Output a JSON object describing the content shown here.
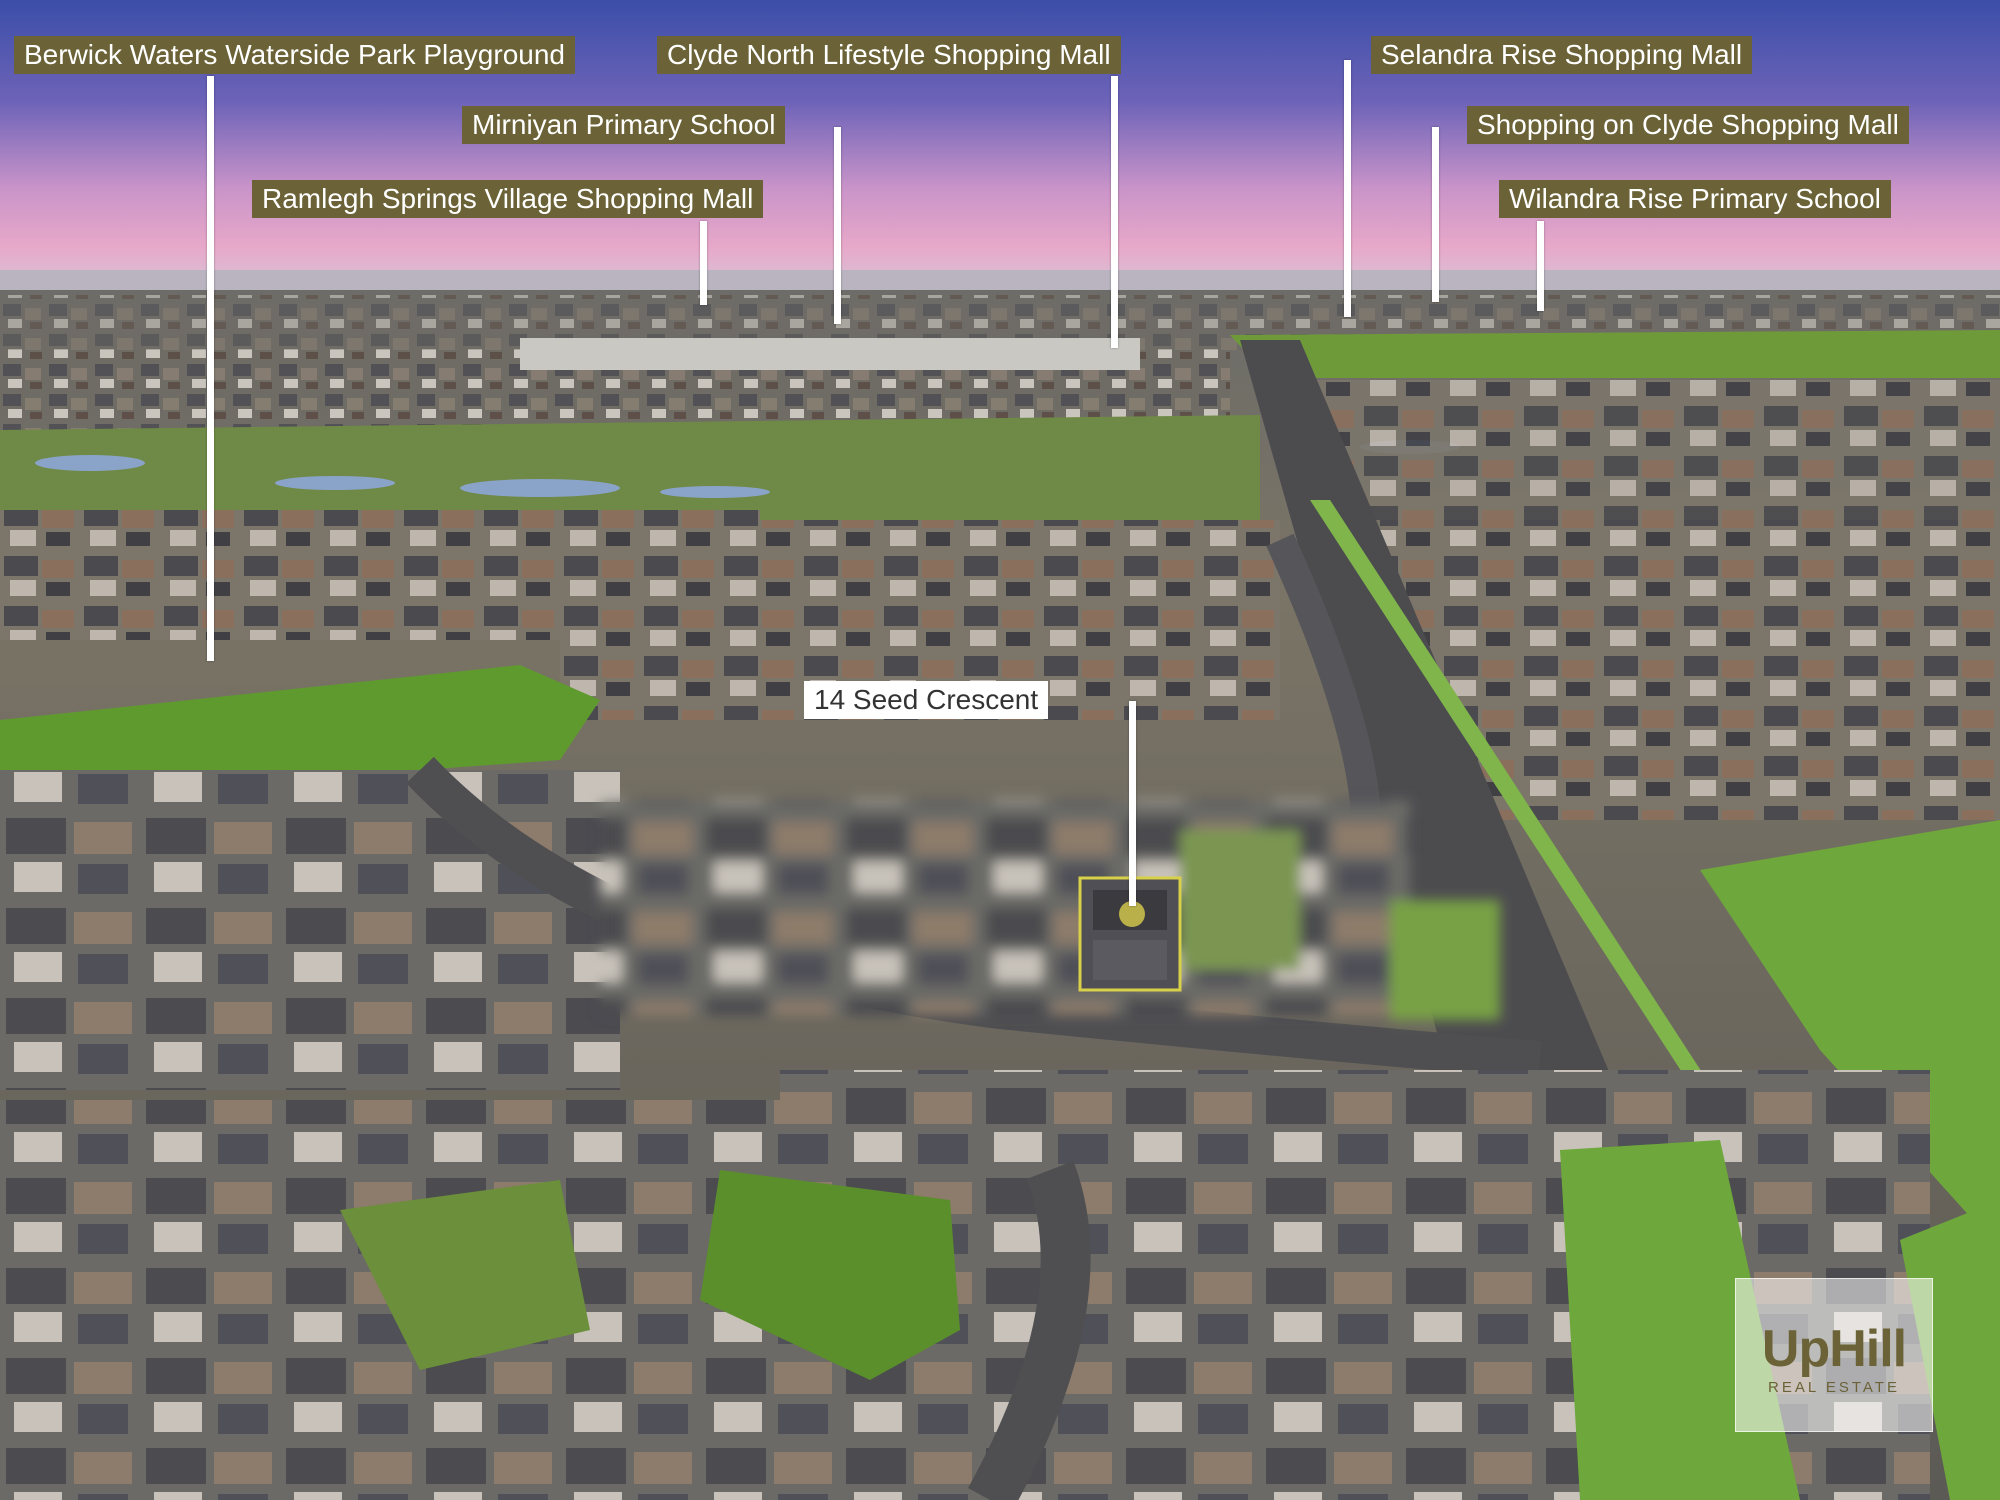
{
  "labels": {
    "berwick": "Berwick Waters Waterside Park Playground",
    "clyde_north": "Clyde North Lifestyle Shopping Mall",
    "selandra": "Selandra Rise Shopping Mall",
    "mirniyan": "Mirniyan Primary School",
    "shopping_on_clyde": "Shopping on Clyde Shopping Mall",
    "ramlegh": "Ramlegh Springs Village Shopping Mall",
    "wilandra": "Wilandra Rise Primary School",
    "property": "14 Seed Crescent"
  },
  "logo": {
    "main": "UpHill",
    "sub": "REAL ESTATE"
  },
  "colors": {
    "label_bg": "#6b6337",
    "label_text": "#ffffff",
    "accent": "#d8d048"
  }
}
